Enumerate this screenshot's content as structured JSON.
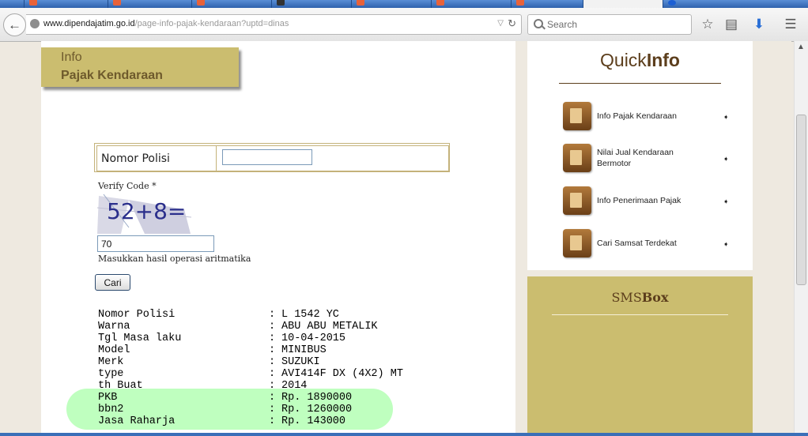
{
  "browser": {
    "url_host": "www.dipendajatim.go.id",
    "url_path": "/page-info-pajak-kendaraan?uptd=dinas",
    "search_placeholder": "Search"
  },
  "page": {
    "header_line1": "Info",
    "header_line2": "Pajak Kendaraan",
    "form_label_nopol": "Nomor Polisi",
    "nopol_value": "",
    "verify_label": "Verify Code *",
    "captcha_text": "52+8=",
    "captcha_answer": "70",
    "captcha_hint": "Masukkan hasil operasi aritmatika",
    "submit_label": "Cari"
  },
  "result": [
    {
      "key": "Nomor Polisi",
      "value": "L 1542 YC"
    },
    {
      "key": "Warna",
      "value": "ABU ABU METALIK"
    },
    {
      "key": "Tgl Masa laku",
      "value": "10-04-2015"
    },
    {
      "key": "Model",
      "value": "MINIBUS"
    },
    {
      "key": "Merk",
      "value": "SUZUKI"
    },
    {
      "key": "type",
      "value": "AVI414F DX (4X2) MT"
    },
    {
      "key": "th Buat",
      "value": "2014"
    },
    {
      "key": "PKB",
      "value": "Rp. 1890000"
    },
    {
      "key": "bbn2",
      "value": "Rp. 1260000"
    },
    {
      "key": "Jasa Raharja",
      "value": "Rp. 143000"
    }
  ],
  "quickinfo": {
    "title_light": "Quick",
    "title_bold": "Info",
    "items": [
      {
        "label": "Info Pajak Kendaraan"
      },
      {
        "label": "Nilai Jual Kendaraan Bermotor"
      },
      {
        "label": "Info Penerimaan Pajak"
      },
      {
        "label": "Cari Samsat Terdekat"
      }
    ]
  },
  "smsbox": {
    "title_light": "SMS",
    "title_bold": "Box"
  },
  "colors": {
    "header_gold": "#cbbd6f",
    "brown_text": "#5c3e1c",
    "highlight_green": "#bfffbf"
  }
}
